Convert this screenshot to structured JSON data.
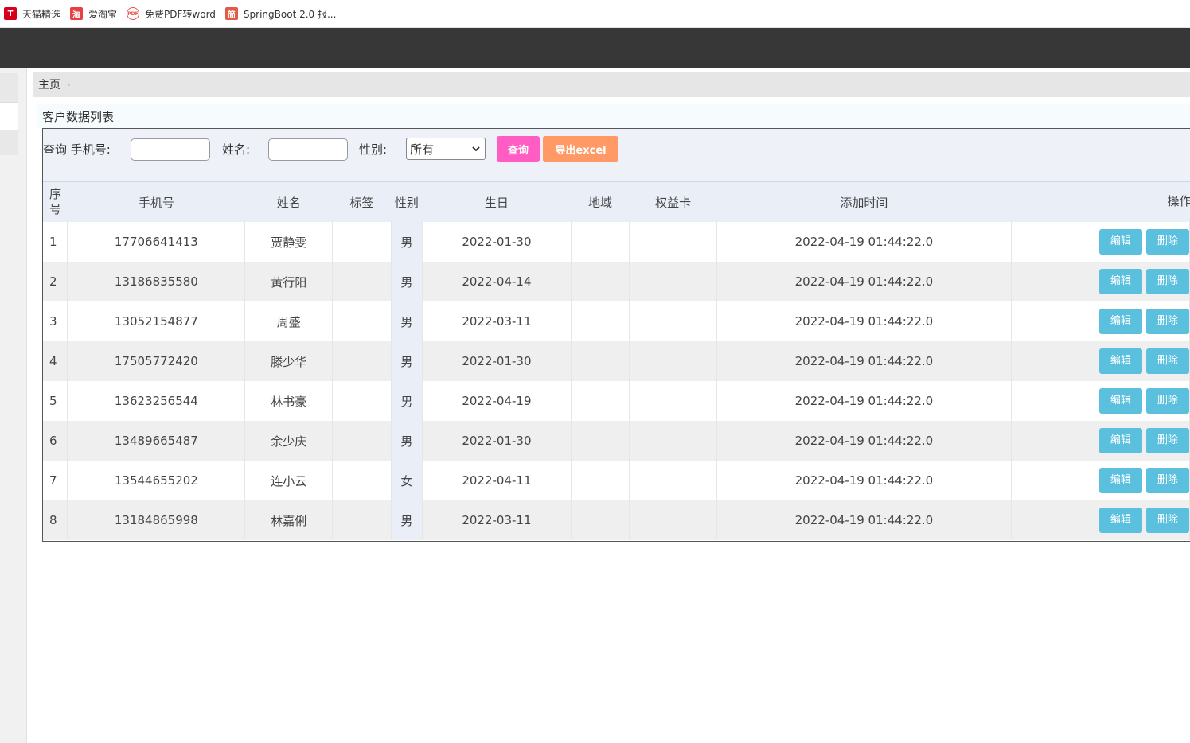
{
  "bookmarks": [
    {
      "icon": "tmall-icon",
      "glyph": "T",
      "label": "天猫精选"
    },
    {
      "icon": "taobao-icon",
      "glyph": "淘",
      "label": "爱淘宝"
    },
    {
      "icon": "pdf-icon",
      "glyph": "PDF",
      "label": "免费PDF转word"
    },
    {
      "icon": "jian-icon",
      "glyph": "简",
      "label": "SpringBoot 2.0 报..."
    }
  ],
  "breadcrumb": {
    "home": "主页",
    "sep": "›"
  },
  "panel": {
    "title": "客户数据列表"
  },
  "search": {
    "query_label": "查询 手机号:",
    "name_label": "姓名:",
    "gender_label": "性别:",
    "gender_value": "所有",
    "query_button": "查询",
    "export_button": "导出excel"
  },
  "table": {
    "headers": {
      "seq": "序号",
      "phone": "手机号",
      "name": "姓名",
      "tag": "标签",
      "gender": "性别",
      "birthday": "生日",
      "region": "地域",
      "card": "权益卡",
      "added": "添加时间",
      "ops": "操作"
    },
    "edit_label": "编辑",
    "delete_label": "删除",
    "rows": [
      {
        "seq": "1",
        "phone": "17706641413",
        "name": "贾静雯",
        "tag": "",
        "gender": "男",
        "birthday": "2022-01-30",
        "region": "",
        "card": "",
        "added": "2022-04-19 01:44:22.0"
      },
      {
        "seq": "2",
        "phone": "13186835580",
        "name": "黄行阳",
        "tag": "",
        "gender": "男",
        "birthday": "2022-04-14",
        "region": "",
        "card": "",
        "added": "2022-04-19 01:44:22.0"
      },
      {
        "seq": "3",
        "phone": "13052154877",
        "name": "周盛",
        "tag": "",
        "gender": "男",
        "birthday": "2022-03-11",
        "region": "",
        "card": "",
        "added": "2022-04-19 01:44:22.0"
      },
      {
        "seq": "4",
        "phone": "17505772420",
        "name": "滕少华",
        "tag": "",
        "gender": "男",
        "birthday": "2022-01-30",
        "region": "",
        "card": "",
        "added": "2022-04-19 01:44:22.0"
      },
      {
        "seq": "5",
        "phone": "13623256544",
        "name": "林书豪",
        "tag": "",
        "gender": "男",
        "birthday": "2022-04-19",
        "region": "",
        "card": "",
        "added": "2022-04-19 01:44:22.0"
      },
      {
        "seq": "6",
        "phone": "13489665487",
        "name": "余少庆",
        "tag": "",
        "gender": "男",
        "birthday": "2022-01-30",
        "region": "",
        "card": "",
        "added": "2022-04-19 01:44:22.0"
      },
      {
        "seq": "7",
        "phone": "13544655202",
        "name": "连小云",
        "tag": "",
        "gender": "女",
        "birthday": "2022-04-11",
        "region": "",
        "card": "",
        "added": "2022-04-19 01:44:22.0"
      },
      {
        "seq": "8",
        "phone": "13184865998",
        "name": "林嘉俐",
        "tag": "",
        "gender": "男",
        "birthday": "2022-03-11",
        "region": "",
        "card": "",
        "added": "2022-04-19 01:44:22.0"
      }
    ]
  }
}
